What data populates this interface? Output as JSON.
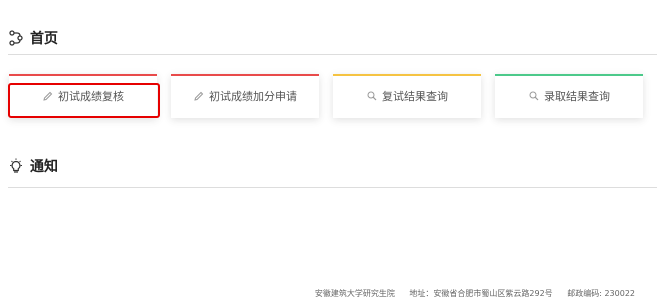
{
  "home": {
    "title": "首页",
    "icon": "nodes-icon"
  },
  "cards": [
    {
      "label": "初试成绩复核",
      "icon": "pencil-icon",
      "accent": "#e84a4a"
    },
    {
      "label": "初试成绩加分申请",
      "icon": "pencil-icon",
      "accent": "#e84a4a"
    },
    {
      "label": "复试结果查询",
      "icon": "search-icon",
      "accent": "#f5c342"
    },
    {
      "label": "录取结果查询",
      "icon": "search-icon",
      "accent": "#4cc98a"
    }
  ],
  "notice": {
    "title": "通知",
    "icon": "lightbulb-icon"
  },
  "footer": {
    "org": "安徽建筑大学研究生院",
    "address": "地址：安徽省合肥市蜀山区紫云路292号",
    "postcode": "邮政编码: 230022"
  },
  "colors": {
    "highlight": "#e60000",
    "divider": "#dddddd"
  }
}
